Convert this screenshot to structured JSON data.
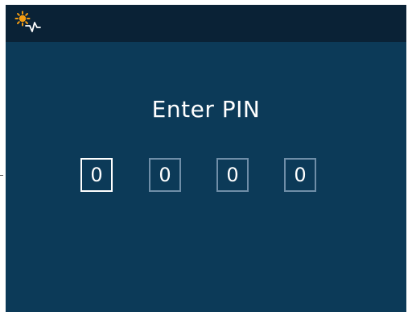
{
  "status_bar": {
    "icon": "sun-heartbeat-icon",
    "icon_colors": {
      "sun": "#f39c12",
      "wave": "#ffffff"
    }
  },
  "pin_screen": {
    "title": "Enter PIN",
    "digits": [
      "0",
      "0",
      "0",
      "0"
    ],
    "active_index": 0
  },
  "colors": {
    "background": "#0c3a58",
    "topbar": "#0a2236",
    "active_border": "#ffffff",
    "inactive_border": "#6f8ea8",
    "text": "#ffffff"
  }
}
